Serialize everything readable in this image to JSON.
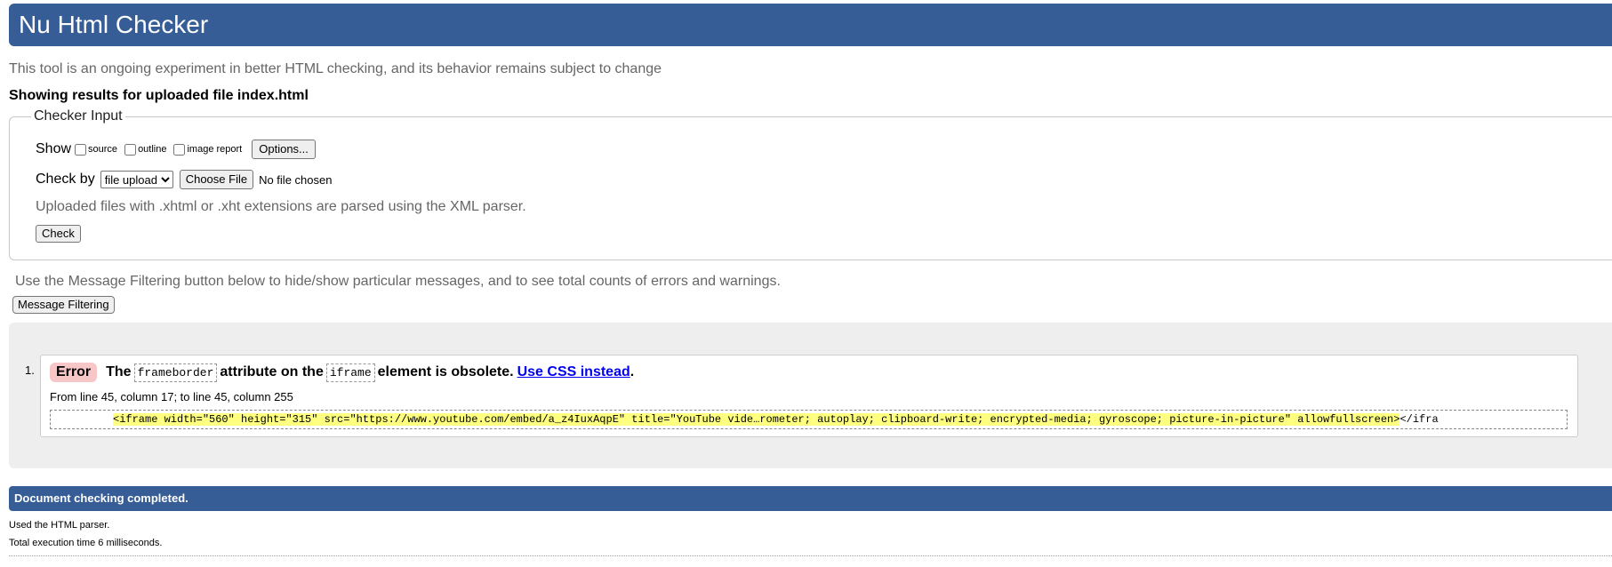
{
  "header": {
    "title": "Nu Html Checker"
  },
  "intro_text": "This tool is an ongoing experiment in better HTML checking, and its behavior remains subject to change",
  "showing_results": "Showing results for uploaded file index.html",
  "checker_input": {
    "legend": "Checker Input",
    "show_label": "Show",
    "options": [
      {
        "label": "source",
        "checked": false
      },
      {
        "label": "outline",
        "checked": false
      },
      {
        "label": "image report",
        "checked": false
      }
    ],
    "options_button": "Options...",
    "check_by_label": "Check by",
    "check_by_selected": "file upload",
    "choose_file_button": "Choose File",
    "no_file_text": "No file chosen",
    "note": "Uploaded files with .xhtml or .xht extensions are parsed using the XML parser.",
    "check_button": "Check"
  },
  "filtering": {
    "note": "Use the Message Filtering button below to hide/show particular messages, and to see total counts of errors and warnings.",
    "button": "Message Filtering"
  },
  "messages": [
    {
      "number": "1.",
      "type": "Error",
      "text_before": "The",
      "code1": "frameborder",
      "text_middle": "attribute on the",
      "code2": "iframe",
      "text_after": "element is obsolete.",
      "link": "Use CSS instead",
      "period": ".",
      "location": "From line 45, column 17; to line 45, column 255",
      "extract_highlight": "<iframe width=\"560\" height=\"315\" src=\"https://www.youtube.com/embed/a_z4IuxAqpE\" title=\"YouTube vide…rometer; autoplay; clipboard-write; encrypted-media; gyroscope; picture-in-picture\" allowfullscreen>",
      "extract_tail": "</ifra"
    }
  ],
  "footer": {
    "completed": "Document checking completed.",
    "parser": "Used the HTML parser.",
    "execution": "Total execution time 6 milliseconds."
  },
  "colors": {
    "header_bg": "#365d95",
    "error_badge": "#f7c6c6",
    "highlight": "#ffff80",
    "results_bg": "#eeeeee"
  }
}
